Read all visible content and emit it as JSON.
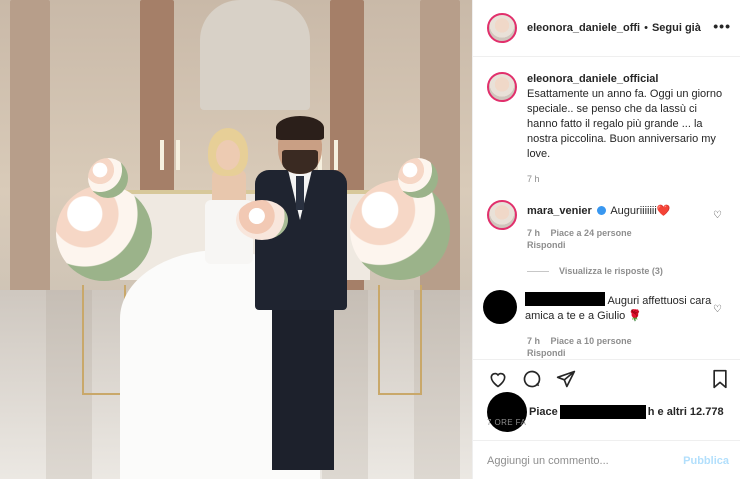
{
  "header": {
    "username": "eleonora_daniele_offi",
    "separator": "•",
    "follow_label": "Segui già",
    "more": "•••"
  },
  "caption": {
    "username": "eleonora_daniele_official",
    "text": "Esattamente un anno fa. Oggi un giorno speciale.. se penso che da lassù ci hanno fatto il regalo più grande ... la nostra piccolina. Buon anniversario my love.",
    "time": "7 h"
  },
  "comments": [
    {
      "username": "mara_venier",
      "verified": true,
      "text": "Auguriiiiiii",
      "emoji": "❤️",
      "time": "7 h",
      "likes": "Piace a 24 persone",
      "reply": "Rispondi",
      "view_replies": "Visualizza le risposte (3)"
    },
    {
      "username": "",
      "text": "Auguri affettuosi cara amica a te e a Giulio",
      "emoji": "🌹",
      "time": "7 h",
      "likes": "Piace a 10 persone",
      "reply": "Rispondi"
    }
  ],
  "actions": {
    "likes_prefix": "Piace",
    "likes_suffix": "h e altri 12.778",
    "time_ago": "7 ORE FA"
  },
  "add_comment": {
    "placeholder": "Aggiungi un commento...",
    "publish": "Pubblica"
  },
  "colors": {
    "link_blue": "#3897f0",
    "publish_disabled": "#b2dffc",
    "story_ring": "#e1306c"
  }
}
